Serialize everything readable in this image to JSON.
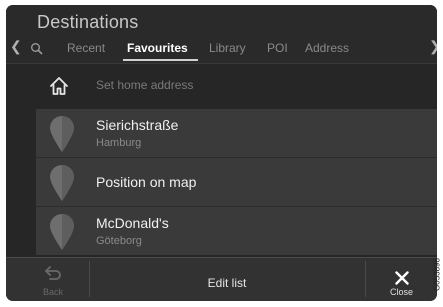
{
  "header": {
    "title": "Destinations",
    "nav_left_icon": "chevron-left-icon",
    "nav_right_icon": "chevron-right-icon",
    "tabs": [
      {
        "label": "Recent"
      },
      {
        "label": "Favourites",
        "active": true
      },
      {
        "label": "Library"
      },
      {
        "label": "POI"
      },
      {
        "label": "Address"
      }
    ],
    "search_icon": "search-icon"
  },
  "home": {
    "icon": "home-icon",
    "label": "Set home address"
  },
  "favourites": [
    {
      "name": "Sierichstraße",
      "sub": "Hamburg",
      "icon": "map-pin-icon"
    },
    {
      "name": "Position on map",
      "sub": "",
      "icon": "map-pin-icon"
    },
    {
      "name": "McDonald's",
      "sub": "Göteborg",
      "icon": "map-pin-icon"
    }
  ],
  "bottom_bar": {
    "back_label": "Back",
    "back_icon": "back-arrow-icon",
    "edit_label": "Edit list",
    "close_label": "Close",
    "close_icon": "close-icon"
  },
  "figure_code": "G053898",
  "colors": {
    "background": "#262626",
    "list_background": "#3a3a3a",
    "active_tab": "#ffffff",
    "inactive_tab": "#8a8a8a"
  }
}
